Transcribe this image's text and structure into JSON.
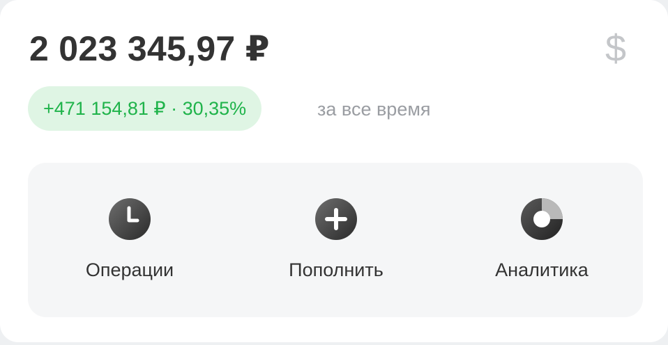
{
  "portfolio": {
    "balance": "2 023 345,97 ₽",
    "currency_icon": "dollar-icon",
    "currency_glyph": "$",
    "profit": "+471 154,81 ₽ · 30,35%",
    "period": "за все время"
  },
  "actions": [
    {
      "label": "Операции",
      "icon": "clock-icon"
    },
    {
      "label": "Пополнить",
      "icon": "plus-icon"
    },
    {
      "label": "Аналитика",
      "icon": "donut-chart-icon"
    }
  ],
  "colors": {
    "profit_text": "#1fb34a",
    "profit_background": "#dff5e4",
    "primary_text": "#333333",
    "secondary_text": "#9a9da2"
  }
}
